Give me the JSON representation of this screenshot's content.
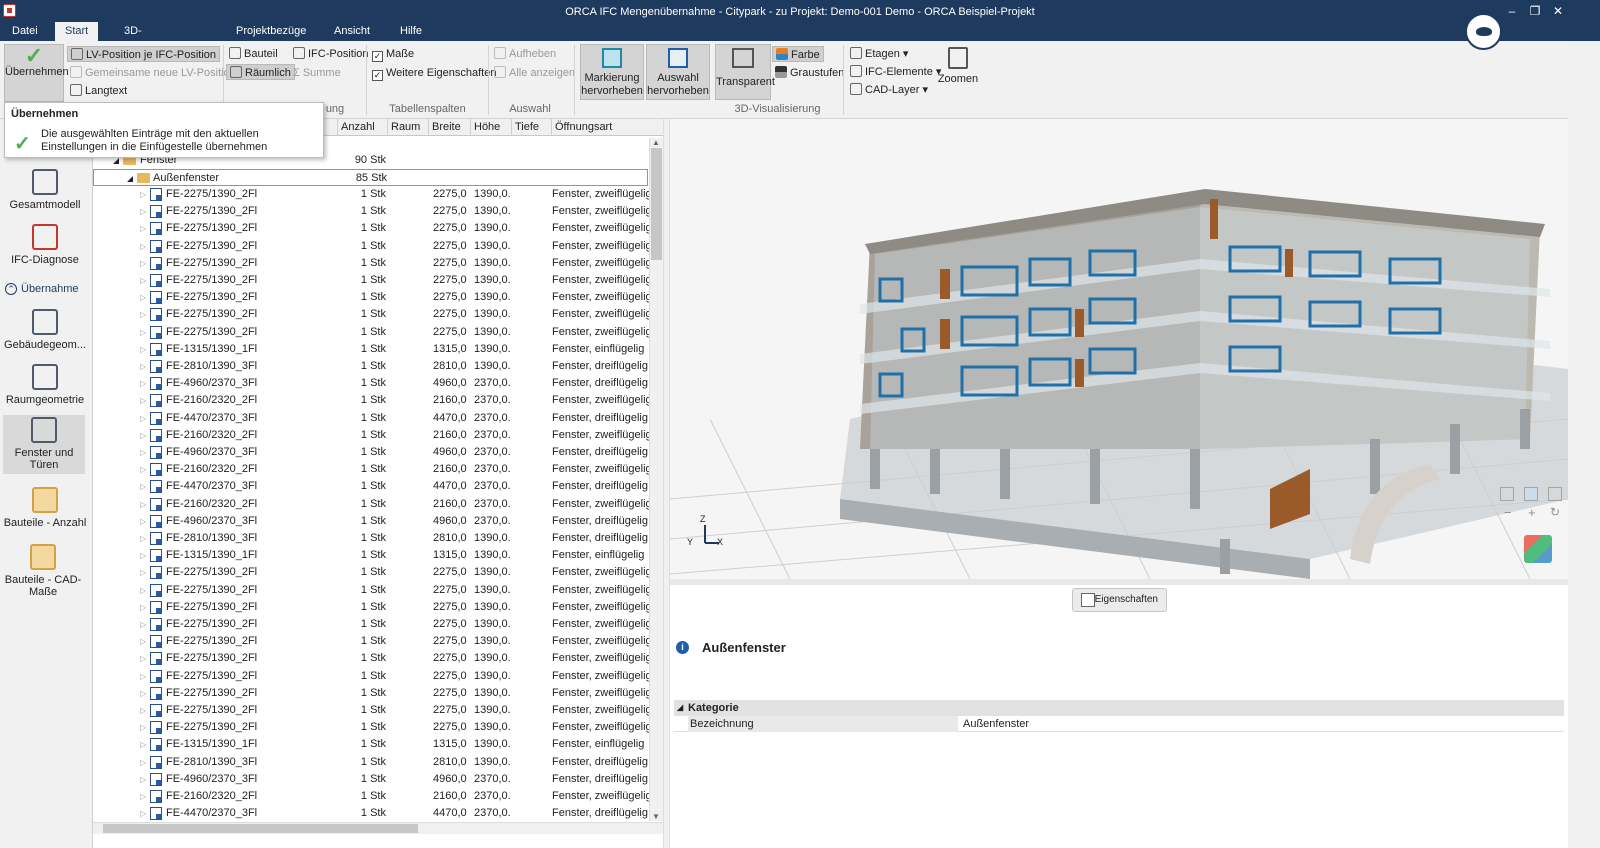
{
  "window": {
    "title": "ORCA IFC Mengenübernahme - Citypark - zu Projekt: Demo-001 Demo - ORCA Beispiel-Projekt"
  },
  "menu_tabs": [
    {
      "label": "Datei"
    },
    {
      "label": "Start"
    },
    {
      "label": "3D-Visualisierung"
    },
    {
      "label": "Projektbezüge"
    },
    {
      "label": "Ansicht"
    },
    {
      "label": "Hilfe"
    }
  ],
  "ribbon": {
    "uebernehmen": "Übernehmen",
    "lv_position": "LV-Position je IFC-Position",
    "gemeinsame": "Gemeinsame neue LV-Position",
    "langtext": "Langtext",
    "bauteil": "Bauteil",
    "raeumlich": "Räumlich",
    "ifc_position": "IFC-Position",
    "summe": "Summe",
    "gliederung_partial": "ung",
    "masse": "Maße",
    "weitere": "Weitere Eigenschaften",
    "tabellenspalten": "Tabellenspalten",
    "aufheben": "Aufheben",
    "alle_anzeigen": "Alle anzeigen",
    "auswahl": "Auswahl",
    "markierung": "Markierung hervorheben",
    "auswahl_hervorheben": "Auswahl hervorheben",
    "transparent": "Transparent",
    "farbe": "Farbe",
    "graustufen": "Graustufen",
    "visualisierung": "3D-Visualisierung",
    "etagen": "Etagen",
    "ifc_elemente": "IFC-Elemente",
    "cad_layer": "CAD-Layer",
    "zoomen": "Zoomen"
  },
  "tooltip": {
    "title": "Übernehmen",
    "text": "Die ausgewählten Einträge mit den aktuellen Einstellungen in die Einfügestelle übernehmen"
  },
  "sidebar": {
    "items": [
      {
        "label": "Gesamtmodell"
      },
      {
        "label": "IFC-Diagnose"
      },
      {
        "label": "Übernahme"
      },
      {
        "label": "Gebäudegeom..."
      },
      {
        "label": "Raumgeometrie"
      },
      {
        "label": "Fenster und Türen"
      },
      {
        "label": "Bauteile - Anzahl"
      },
      {
        "label": "Bauteile - CAD-Maße"
      }
    ]
  },
  "grid": {
    "columns": [
      {
        "label": "Anzahl"
      },
      {
        "label": "Raum"
      },
      {
        "label": "Breite"
      },
      {
        "label": "Höhe"
      },
      {
        "label": "Tiefe"
      },
      {
        "label": "Öffnungsart"
      }
    ],
    "group1": {
      "name": "Fenster",
      "count": "90 Stk"
    },
    "group2": {
      "name": "Außenfenster",
      "count": "85 Stk"
    },
    "rows": [
      {
        "name": "FE-2275/1390_2Fl",
        "count": "1 Stk",
        "breite": "2275,0...",
        "hoehe": "1390,0...",
        "art": "Fenster, zweiflügelig"
      },
      {
        "name": "FE-2275/1390_2Fl",
        "count": "1 Stk",
        "breite": "2275,0...",
        "hoehe": "1390,0...",
        "art": "Fenster, zweiflügelig"
      },
      {
        "name": "FE-2275/1390_2Fl",
        "count": "1 Stk",
        "breite": "2275,0...",
        "hoehe": "1390,0...",
        "art": "Fenster, zweiflügelig"
      },
      {
        "name": "FE-2275/1390_2Fl",
        "count": "1 Stk",
        "breite": "2275,0...",
        "hoehe": "1390,0...",
        "art": "Fenster, zweiflügelig"
      },
      {
        "name": "FE-2275/1390_2Fl",
        "count": "1 Stk",
        "breite": "2275,0...",
        "hoehe": "1390,0...",
        "art": "Fenster, zweiflügelig"
      },
      {
        "name": "FE-2275/1390_2Fl",
        "count": "1 Stk",
        "breite": "2275,0...",
        "hoehe": "1390,0...",
        "art": "Fenster, zweiflügelig"
      },
      {
        "name": "FE-2275/1390_2Fl",
        "count": "1 Stk",
        "breite": "2275,0...",
        "hoehe": "1390,0...",
        "art": "Fenster, zweiflügelig"
      },
      {
        "name": "FE-2275/1390_2Fl",
        "count": "1 Stk",
        "breite": "2275,0...",
        "hoehe": "1390,0...",
        "art": "Fenster, zweiflügelig"
      },
      {
        "name": "FE-2275/1390_2Fl",
        "count": "1 Stk",
        "breite": "2275,0...",
        "hoehe": "1390,0...",
        "art": "Fenster, zweiflügelig"
      },
      {
        "name": "FE-1315/1390_1Fl",
        "count": "1 Stk",
        "breite": "1315,0...",
        "hoehe": "1390,0...",
        "art": "Fenster, einflügelig"
      },
      {
        "name": "FE-2810/1390_3Fl",
        "count": "1 Stk",
        "breite": "2810,0...",
        "hoehe": "1390,0...",
        "art": "Fenster, dreiflügelig"
      },
      {
        "name": "FE-4960/2370_3Fl",
        "count": "1 Stk",
        "breite": "4960,0...",
        "hoehe": "2370,0...",
        "art": "Fenster, dreiflügelig"
      },
      {
        "name": "FE-2160/2320_2Fl",
        "count": "1 Stk",
        "breite": "2160,0...",
        "hoehe": "2370,0...",
        "art": "Fenster, zweiflügelig"
      },
      {
        "name": "FE-4470/2370_3Fl",
        "count": "1 Stk",
        "breite": "4470,0...",
        "hoehe": "2370,0...",
        "art": "Fenster, dreiflügelig"
      },
      {
        "name": "FE-2160/2320_2Fl",
        "count": "1 Stk",
        "breite": "2160,0...",
        "hoehe": "2370,0...",
        "art": "Fenster, zweiflügelig"
      },
      {
        "name": "FE-4960/2370_3Fl",
        "count": "1 Stk",
        "breite": "4960,0...",
        "hoehe": "2370,0...",
        "art": "Fenster, dreiflügelig"
      },
      {
        "name": "FE-2160/2320_2Fl",
        "count": "1 Stk",
        "breite": "2160,0...",
        "hoehe": "2370,0...",
        "art": "Fenster, zweiflügelig"
      },
      {
        "name": "FE-4470/2370_3Fl",
        "count": "1 Stk",
        "breite": "4470,0...",
        "hoehe": "2370,0...",
        "art": "Fenster, dreiflügelig"
      },
      {
        "name": "FE-2160/2320_2Fl",
        "count": "1 Stk",
        "breite": "2160,0...",
        "hoehe": "2370,0...",
        "art": "Fenster, zweiflügelig"
      },
      {
        "name": "FE-4960/2370_3Fl",
        "count": "1 Stk",
        "breite": "4960,0...",
        "hoehe": "2370,0...",
        "art": "Fenster, dreiflügelig"
      },
      {
        "name": "FE-2810/1390_3Fl",
        "count": "1 Stk",
        "breite": "2810,0...",
        "hoehe": "1390,0...",
        "art": "Fenster, dreiflügelig"
      },
      {
        "name": "FE-1315/1390_1Fl",
        "count": "1 Stk",
        "breite": "1315,0...",
        "hoehe": "1390,0...",
        "art": "Fenster, einflügelig"
      },
      {
        "name": "FE-2275/1390_2Fl",
        "count": "1 Stk",
        "breite": "2275,0...",
        "hoehe": "1390,0...",
        "art": "Fenster, zweiflügelig"
      },
      {
        "name": "FE-2275/1390_2Fl",
        "count": "1 Stk",
        "breite": "2275,0...",
        "hoehe": "1390,0...",
        "art": "Fenster, zweiflügelig"
      },
      {
        "name": "FE-2275/1390_2Fl",
        "count": "1 Stk",
        "breite": "2275,0...",
        "hoehe": "1390,0...",
        "art": "Fenster, zweiflügelig"
      },
      {
        "name": "FE-2275/1390_2Fl",
        "count": "1 Stk",
        "breite": "2275,0...",
        "hoehe": "1390,0...",
        "art": "Fenster, zweiflügelig"
      },
      {
        "name": "FE-2275/1390_2Fl",
        "count": "1 Stk",
        "breite": "2275,0...",
        "hoehe": "1390,0...",
        "art": "Fenster, zweiflügelig"
      },
      {
        "name": "FE-2275/1390_2Fl",
        "count": "1 Stk",
        "breite": "2275,0...",
        "hoehe": "1390,0...",
        "art": "Fenster, zweiflügelig"
      },
      {
        "name": "FE-2275/1390_2Fl",
        "count": "1 Stk",
        "breite": "2275,0...",
        "hoehe": "1390,0...",
        "art": "Fenster, zweiflügelig"
      },
      {
        "name": "FE-2275/1390_2Fl",
        "count": "1 Stk",
        "breite": "2275,0...",
        "hoehe": "1390,0...",
        "art": "Fenster, zweiflügelig"
      },
      {
        "name": "FE-2275/1390_2Fl",
        "count": "1 Stk",
        "breite": "2275,0...",
        "hoehe": "1390,0...",
        "art": "Fenster, zweiflügelig"
      },
      {
        "name": "FE-2275/1390_2Fl",
        "count": "1 Stk",
        "breite": "2275,0...",
        "hoehe": "1390,0...",
        "art": "Fenster, zweiflügelig"
      },
      {
        "name": "FE-1315/1390_1Fl",
        "count": "1 Stk",
        "breite": "1315,0...",
        "hoehe": "1390,0...",
        "art": "Fenster, einflügelig"
      },
      {
        "name": "FE-2810/1390_3Fl",
        "count": "1 Stk",
        "breite": "2810,0...",
        "hoehe": "1390,0...",
        "art": "Fenster, dreiflügelig"
      },
      {
        "name": "FE-4960/2370_3Fl",
        "count": "1 Stk",
        "breite": "4960,0...",
        "hoehe": "2370,0...",
        "art": "Fenster, dreiflügelig"
      },
      {
        "name": "FE-2160/2320_2Fl",
        "count": "1 Stk",
        "breite": "2160,0...",
        "hoehe": "2370,0...",
        "art": "Fenster, zweiflügelig"
      },
      {
        "name": "FE-4470/2370_3Fl",
        "count": "1 Stk",
        "breite": "4470,0...",
        "hoehe": "2370,0...",
        "art": "Fenster, dreiflügelig"
      }
    ]
  },
  "viewport": {
    "axis_z": "Z",
    "axis_y": "Y",
    "axis_x": "X",
    "zoom_minus": "−",
    "zoom_plus": "+"
  },
  "properties": {
    "button": "Eigenschaften",
    "title": "Außenfenster",
    "category": "Kategorie",
    "field_label": "Bezeichnung",
    "field_value": "Außenfenster"
  },
  "colors": {
    "titlebar": "#1f3a5f",
    "window_frame": "#1f6fa8",
    "wood": "#9a5a2a",
    "concrete": "#b8b3ab"
  }
}
